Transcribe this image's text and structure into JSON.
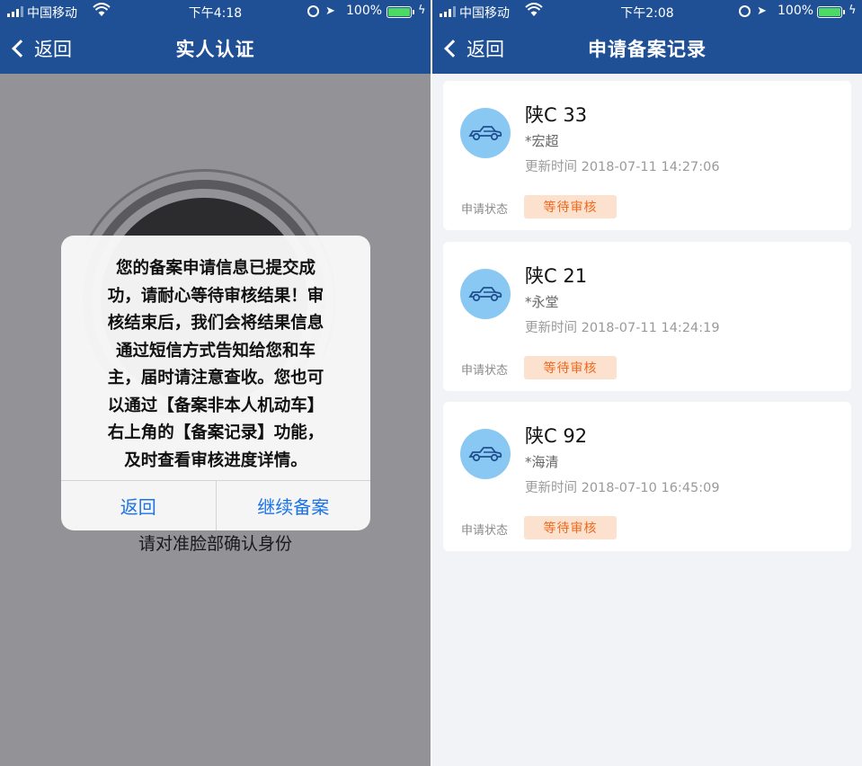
{
  "left_screen": {
    "status": {
      "carrier": "中国移动",
      "time": "下午4:18",
      "battery": "100%"
    },
    "nav": {
      "back": "返回",
      "title": "实人认证"
    },
    "instruction": "请对准脸部确认身份",
    "dialog": {
      "lines": [
        "您的备案申请信息已提交成",
        "功，请耐心等待审核结果！审",
        "核结束后，我们会将结果信息",
        "通过短信方式告知给您和车",
        "主，届时请注意查收。您也可",
        "以通过【备案非本人机动车】",
        "右上角的【备案记录】功能，",
        "及时查看审核进度详情。"
      ],
      "cancel": "返回",
      "confirm": "继续备案"
    }
  },
  "right_screen": {
    "status": {
      "carrier": "中国移动",
      "time": "下午2:08",
      "battery": "100%"
    },
    "nav": {
      "back": "返回",
      "title": "申请备案记录"
    },
    "records": [
      {
        "plate": "陕C  33",
        "owner": "*宏超",
        "updated": "更新时间 2018-07-11 14:27:06",
        "status_label": "申请状态",
        "status": "等待审核"
      },
      {
        "plate": "陕C  21",
        "owner": "*永堂",
        "updated": "更新时间 2018-07-11 14:24:19",
        "status_label": "申请状态",
        "status": "等待审核"
      },
      {
        "plate": "陕C  92",
        "owner": "*海清",
        "updated": "更新时间 2018-07-10 16:45:09",
        "status_label": "申请状态",
        "status": "等待审核"
      }
    ]
  },
  "icons": {
    "signal": "signal-icon",
    "wifi": "wifi-icon",
    "battery": "battery-icon",
    "back": "chevron-left-icon",
    "car": "car-icon"
  },
  "colors": {
    "navbar": "#1f5096",
    "link": "#1a73e8",
    "badge_bg": "#fde1cf",
    "badge_text": "#ee6a1c",
    "avatar": "#89c8f3"
  }
}
